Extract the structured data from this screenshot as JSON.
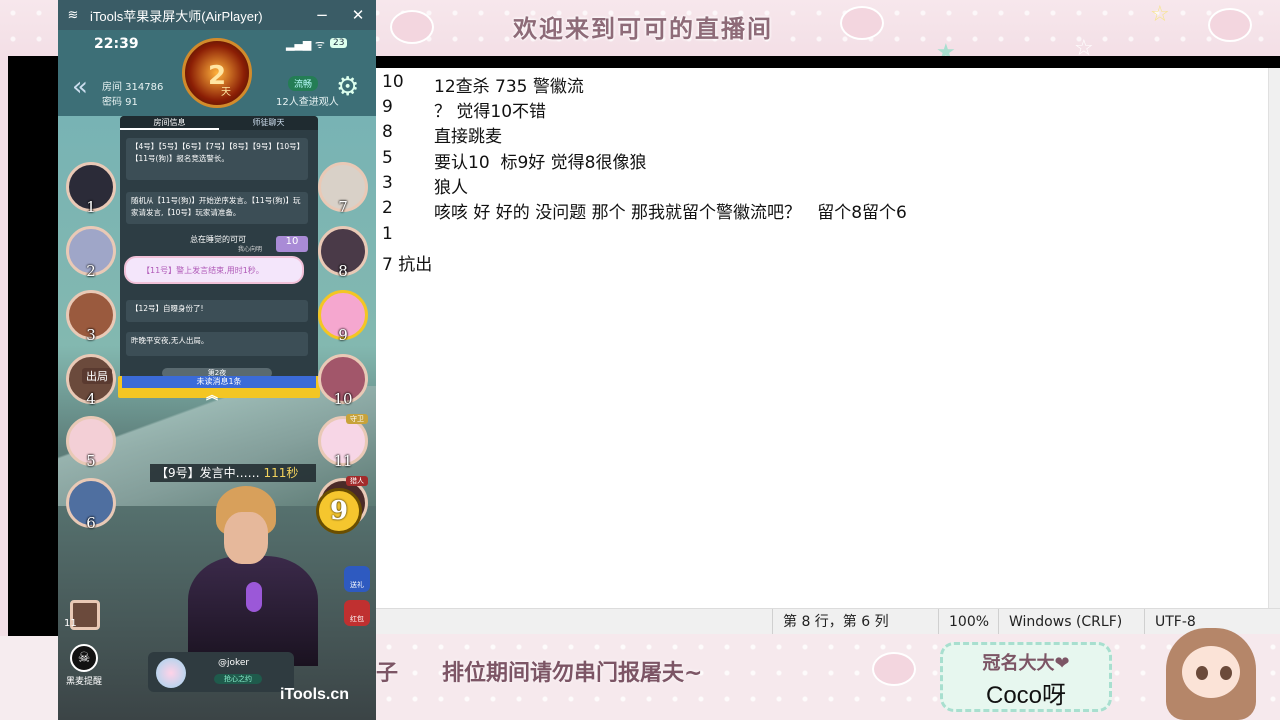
{
  "overlay": {
    "banner_title": "欢迎来到可可的直播间",
    "marquee": "子　　排位期间请勿串门报屠夫~",
    "sponsor_label": "冠名大大❤",
    "sponsor_name": "Coco呀"
  },
  "phone_window": {
    "title": "iTools苹果录屏大师(AirPlayer)",
    "minimize": "−",
    "close": "✕",
    "watermark": "iTools.cn"
  },
  "phone_status": {
    "time": "22:39",
    "signal": "▂▄▆ ᯤ",
    "battery": "23"
  },
  "room": {
    "room_id": "房间 314786",
    "password": "密码 91",
    "day_number": "2",
    "day_label": "天",
    "flow_badge": "流畅",
    "watchers": "12人查进观人"
  },
  "chat": {
    "tabs": [
      "房间信息",
      "师徒聊天"
    ],
    "messages": [
      "【4号】【5号】【6号】【7号】【8号】【9号】【10号】【11号(狗)】报名竞选警长。",
      "随机从【11号(狗)】开始逆序发言。【11号(狗)】玩家请发言,【10号】玩家请准备。",
      "【12号】自曝身份了!",
      "昨晚平安夜,无人出局。"
    ],
    "like_name": "总在睡觉的可可",
    "like_sub": "我心向明",
    "like_count": "10",
    "purple_msg": "【11号】警上发言结束,用时1秒。",
    "day_tag": "第2夜",
    "unread": "未读消息1条",
    "chevron": "︽"
  },
  "seats": [
    {
      "num": "1",
      "color": "#2b2b38"
    },
    {
      "num": "2",
      "color": "#9fa6c8"
    },
    {
      "num": "3",
      "color": "#9a5a3e"
    },
    {
      "num": "4",
      "color": "#6b4a3c",
      "tag": "出局"
    },
    {
      "num": "5",
      "color": "#f3cfd6"
    },
    {
      "num": "6",
      "color": "#4f6fa0"
    },
    {
      "num": "7",
      "color": "#d9d1c8"
    },
    {
      "num": "8",
      "color": "#4a3a48"
    },
    {
      "num": "9",
      "color": "#f5a7cf"
    },
    {
      "num": "10",
      "color": "#a2566a"
    },
    {
      "num": "11",
      "color": "#f7d6e6",
      "tag": "守卫"
    },
    {
      "num": "12",
      "color": "#4a2a28",
      "tag": "猎人"
    }
  ],
  "speaking": {
    "label": "【9号】发言中……",
    "seconds": "111秒",
    "current_seat": "9"
  },
  "side_buttons": {
    "gift": "送礼",
    "redpacket": "红包",
    "report": "黑麦提醒",
    "small_seat": "11"
  },
  "dock": {
    "name": "@joker",
    "sub": "抢心之约"
  },
  "notepad": {
    "lines": [
      [
        "10",
        "12查杀 735 警徽流"
      ],
      [
        "9",
        "？ 觉得10不错"
      ],
      [
        "8",
        "直接跳麦"
      ],
      [
        "5",
        "要认10  标9好 觉得8很像狼"
      ],
      [
        "3",
        "狼人"
      ],
      [
        "2",
        "咳咳 好 好的 没问题 那个 那我就留个警徽流吧？   留个8留个6"
      ],
      [
        "1",
        ""
      ],
      [
        "7 抗出",
        ""
      ]
    ],
    "status": {
      "position": "第 8 行，第 6 列",
      "zoom": "100%",
      "eol": "Windows (CRLF)",
      "encoding": "UTF-8"
    }
  }
}
